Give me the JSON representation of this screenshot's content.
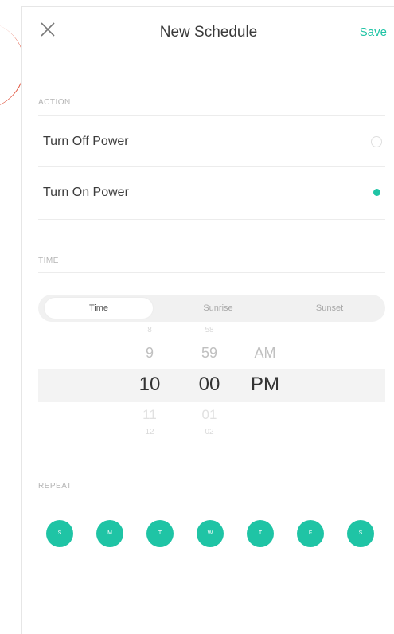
{
  "header": {
    "title": "New Schedule",
    "save_label": "Save",
    "close_icon": "close-icon"
  },
  "action": {
    "section_label": "ACTION",
    "options": [
      {
        "label": "Turn Off Power",
        "selected": false
      },
      {
        "label": "Turn On Power",
        "selected": true
      }
    ]
  },
  "time": {
    "section_label": "TIME",
    "tabs": [
      {
        "label": "Time",
        "active": true
      },
      {
        "label": "Sunrise",
        "active": false
      },
      {
        "label": "Sunset",
        "active": false
      }
    ],
    "picker": {
      "hours": {
        "above_far": "8",
        "above": "9",
        "selected": "10",
        "below": "11",
        "below_far": "12"
      },
      "minutes": {
        "above_far": "58",
        "above": "59",
        "selected": "00",
        "below": "01",
        "below_far": "02"
      },
      "period": {
        "above": "AM",
        "selected": "PM"
      }
    }
  },
  "repeat": {
    "section_label": "REPEAT",
    "days": [
      "S",
      "M",
      "T",
      "W",
      "T",
      "F",
      "S"
    ]
  },
  "colors": {
    "accent": "#1fc4a5",
    "selected_band": "#f3f3f3",
    "annotation": "#e0553f"
  }
}
